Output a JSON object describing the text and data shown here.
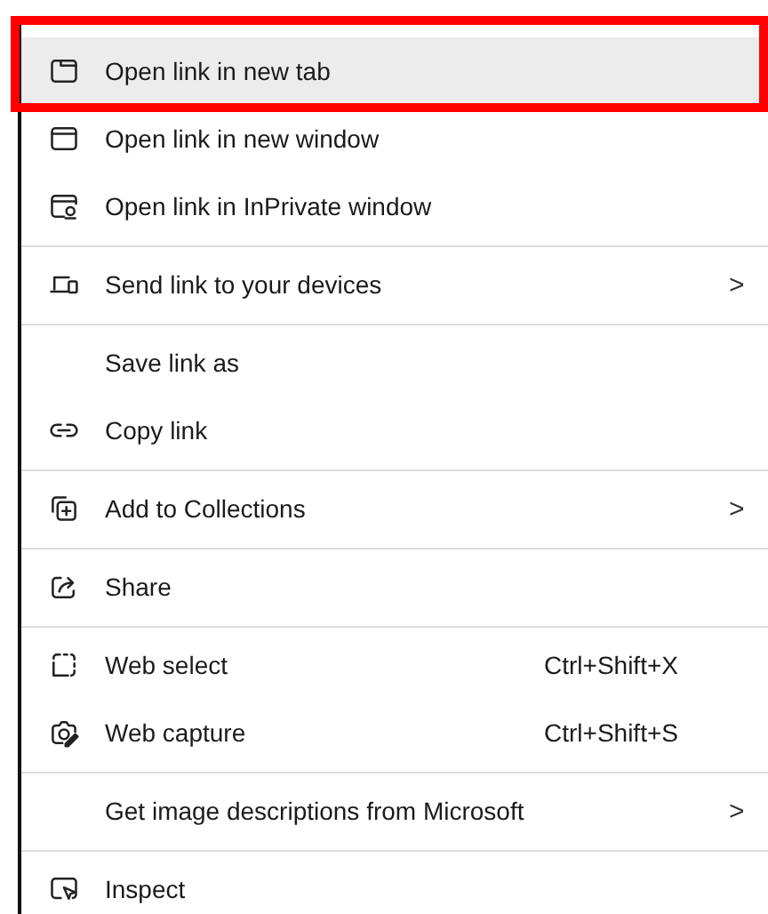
{
  "menu": {
    "items": [
      {
        "kind": "item",
        "label": "Open link in new tab",
        "selected": true
      },
      {
        "kind": "item",
        "label": "Open link in new window",
        "selected": false
      },
      {
        "kind": "item",
        "label": "Open link in InPrivate window",
        "selected": false
      },
      {
        "kind": "separator"
      },
      {
        "kind": "item",
        "label": "Send link to your devices",
        "selected": false,
        "chevron": ">"
      },
      {
        "kind": "separator"
      },
      {
        "kind": "item",
        "label": "Save link as",
        "selected": false
      },
      {
        "kind": "item",
        "label": "Copy link",
        "selected": false
      },
      {
        "kind": "separator"
      },
      {
        "kind": "item",
        "label": "Add to Collections",
        "selected": false,
        "chevron": ">"
      },
      {
        "kind": "separator"
      },
      {
        "kind": "item",
        "label": "Share",
        "selected": false
      },
      {
        "kind": "separator"
      },
      {
        "kind": "item",
        "label": "Web select",
        "shortcut": "Ctrl+Shift+X",
        "selected": false
      },
      {
        "kind": "item",
        "label": "Web capture",
        "shortcut": "Ctrl+Shift+S",
        "selected": false
      },
      {
        "kind": "separator"
      },
      {
        "kind": "item",
        "label": "Get image descriptions from Microsoft",
        "selected": false,
        "chevron": ">"
      },
      {
        "kind": "separator"
      },
      {
        "kind": "item",
        "label": "Inspect",
        "selected": false
      }
    ]
  }
}
